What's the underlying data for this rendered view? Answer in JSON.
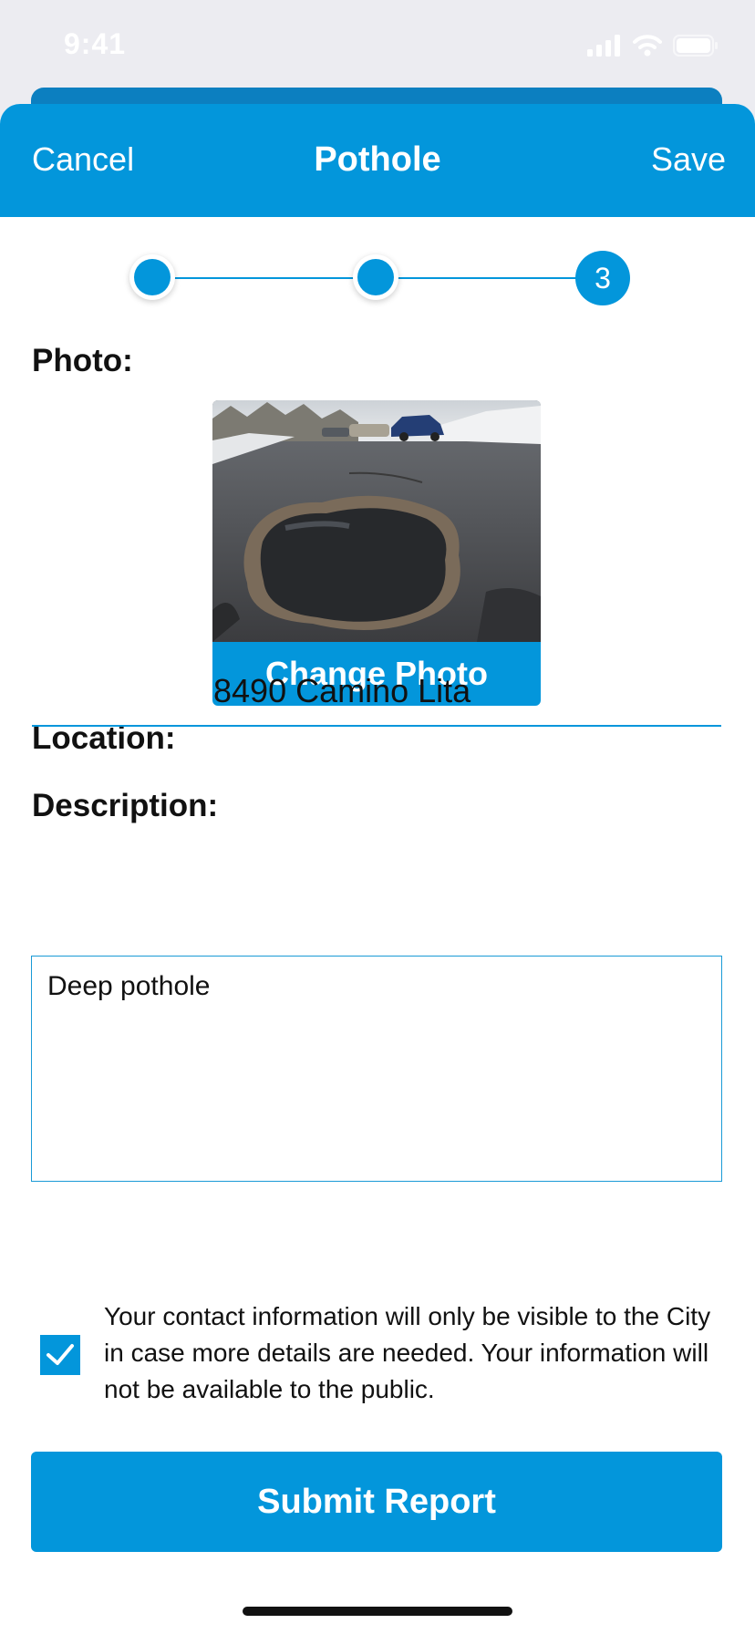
{
  "status_bar": {
    "time": "9:41"
  },
  "header": {
    "cancel_label": "Cancel",
    "title": "Pothole",
    "save_label": "Save"
  },
  "stepper": {
    "current_step_label": "3"
  },
  "photo": {
    "label": "Photo:",
    "change_label": "Change Photo"
  },
  "location": {
    "label": "Location:",
    "value": "8490 Camino Lita"
  },
  "description": {
    "label": "Description:",
    "value": "Deep pothole"
  },
  "consent": {
    "checked": true,
    "text": "Your contact information will only be visible to the City in case more details are needed. Your information will not be available to the public."
  },
  "submit": {
    "label": "Submit Report"
  },
  "colors": {
    "accent": "#0396db",
    "sheet_back": "#0c7fc0",
    "background": "#ececf1"
  },
  "icons": [
    "signal-icon",
    "wifi-icon",
    "battery-icon",
    "checkmark-icon"
  ]
}
